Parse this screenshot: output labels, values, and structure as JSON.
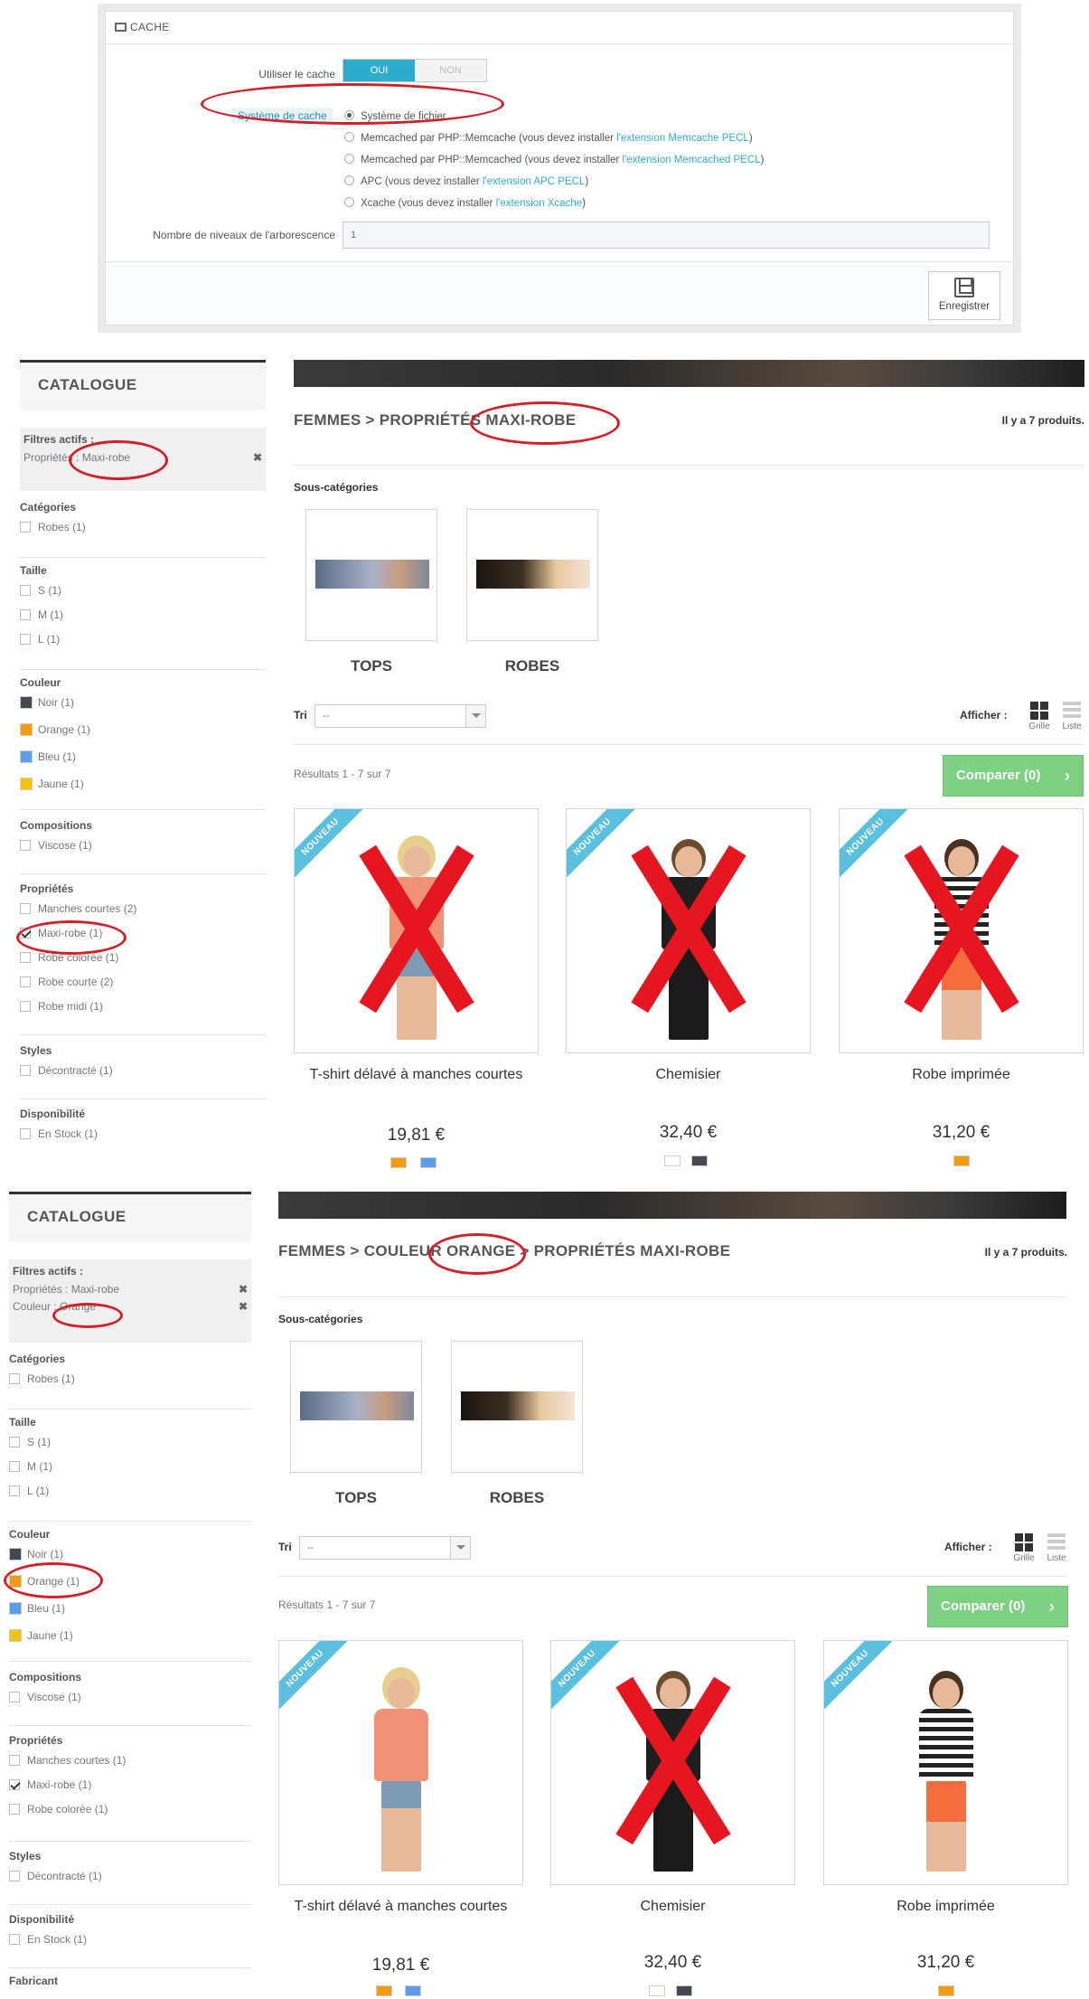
{
  "cache": {
    "title": "CACHE",
    "use_cache_label": "Utiliser le cache",
    "toggle_yes": "OUI",
    "toggle_no": "NON",
    "system_label": "Système de cache",
    "options": [
      {
        "text": "Système de fichier",
        "selected": true
      },
      {
        "text": "Memcached par PHP::Memcache (vous devez installer ",
        "link": "l'extension Memcache PECL",
        "after": ")"
      },
      {
        "text": "Memcached par PHP::Memcached (vous devez installer ",
        "link": "l'extension Memcached PECL",
        "after": ")"
      },
      {
        "text": "APC (vous devez installer ",
        "link": "l'extension APC PECL",
        "after": ")"
      },
      {
        "text": "Xcache (vous devez installer ",
        "link": "l'extension Xcache",
        "after": ")"
      }
    ],
    "depth_label": "Nombre de niveaux de l'arborescence",
    "depth_value": "1",
    "save_label": "Enregistrer"
  },
  "shop1": {
    "catalog_title": "CATALOGUE",
    "active_filters_title": "Filtres actifs :",
    "active_filters": [
      "Propriétés : Maxi-robe"
    ],
    "breadcrumb": "FEMMES > PROPRIÉTÉS MAXI-ROBE",
    "count": "Il y a 7 produits.",
    "filters": {
      "categories": {
        "title": "Catégories",
        "items": [
          "Robes (1)"
        ]
      },
      "size": {
        "title": "Taille",
        "items": [
          "S (1)",
          "M (1)",
          "L (1)"
        ]
      },
      "color": {
        "title": "Couleur",
        "items": [
          {
            "label": "Noir (1)",
            "color": "#434a54"
          },
          {
            "label": "Orange (1)",
            "color": "#f39c11"
          },
          {
            "label": "Bleu (1)",
            "color": "#5d9cec"
          },
          {
            "label": "Jaune (1)",
            "color": "#f1c40f"
          }
        ]
      },
      "compositions": {
        "title": "Compositions",
        "items": [
          "Viscose (1)"
        ]
      },
      "properties": {
        "title": "Propriétés",
        "items": [
          "Manches courtes (2)",
          "Maxi-robe (1)",
          "Robe colorée (1)",
          "Robe courte (2)",
          "Robe midi (1)"
        ]
      },
      "styles": {
        "title": "Styles",
        "items": [
          "Décontracté (1)"
        ]
      },
      "availability": {
        "title": "Disponibilité",
        "items": [
          "En Stock (1)"
        ]
      }
    },
    "products": [
      {
        "name": "T-shirt délavé à manches courtes",
        "price": "19,81 €",
        "badge": "NOUVEAU",
        "crossed": true
      },
      {
        "name": "Chemisier",
        "price": "32,40 €",
        "badge": "NOUVEAU",
        "crossed": true
      },
      {
        "name": "Robe imprimée",
        "price": "31,20 €",
        "badge": "NOUVEAU",
        "crossed": true
      }
    ]
  },
  "shop2": {
    "catalog_title": "CATALOGUE",
    "active_filters_title": "Filtres actifs :",
    "active_filters": [
      "Propriétés : Maxi-robe",
      "Couleur : Orange"
    ],
    "breadcrumb": "FEMMES > COULEUR ORANGE > PROPRIÉTÉS MAXI-ROBE",
    "count": "Il y a 7 produits.",
    "filters": {
      "categories": {
        "title": "Catégories",
        "items": [
          "Robes (1)"
        ]
      },
      "size": {
        "title": "Taille",
        "items": [
          "S (1)",
          "M (1)",
          "L (1)"
        ]
      },
      "color": {
        "title": "Couleur",
        "items": [
          {
            "label": "Noir (1)",
            "color": "#434a54"
          },
          {
            "label": "Orange (1)",
            "color": "#f39c11"
          },
          {
            "label": "Bleu (1)",
            "color": "#5d9cec"
          },
          {
            "label": "Jaune (1)",
            "color": "#f1c40f"
          }
        ]
      },
      "compositions": {
        "title": "Compositions",
        "items": [
          "Viscose (1)"
        ]
      },
      "properties": {
        "title": "Propriétés",
        "items": [
          "Manches courtes (1)",
          "Maxi-robe (1)",
          "Robe colorée (1)"
        ]
      },
      "styles": {
        "title": "Styles",
        "items": [
          "Décontracté (1)"
        ]
      },
      "availability": {
        "title": "Disponibilité",
        "items": [
          "En Stock (1)"
        ]
      },
      "manufacturer": {
        "title": "Fabricant"
      }
    },
    "products": [
      {
        "name": "T-shirt délavé à manches courtes",
        "price": "19,81 €",
        "badge": "NOUVEAU",
        "crossed": false
      },
      {
        "name": "Chemisier",
        "price": "32,40 €",
        "badge": "NOUVEAU",
        "crossed": true
      },
      {
        "name": "Robe imprimée",
        "price": "31,20 €",
        "badge": "NOUVEAU",
        "crossed": false
      }
    ]
  },
  "common": {
    "subcategories_title": "Sous-catégories",
    "subcategories": [
      "TOPS",
      "ROBES"
    ],
    "sort_label": "Tri",
    "sort_value": "--",
    "show_label": "Afficher :",
    "view_grid": "Grille",
    "view_list": "Liste",
    "results": "Résultats 1 - 7 sur 7",
    "compare": "Comparer (0)"
  },
  "colors": {
    "accent": "#2eacce",
    "compare_green": "#7ed083",
    "annotation_red": "#d0202a",
    "badge_blue": "#5bc0de"
  }
}
